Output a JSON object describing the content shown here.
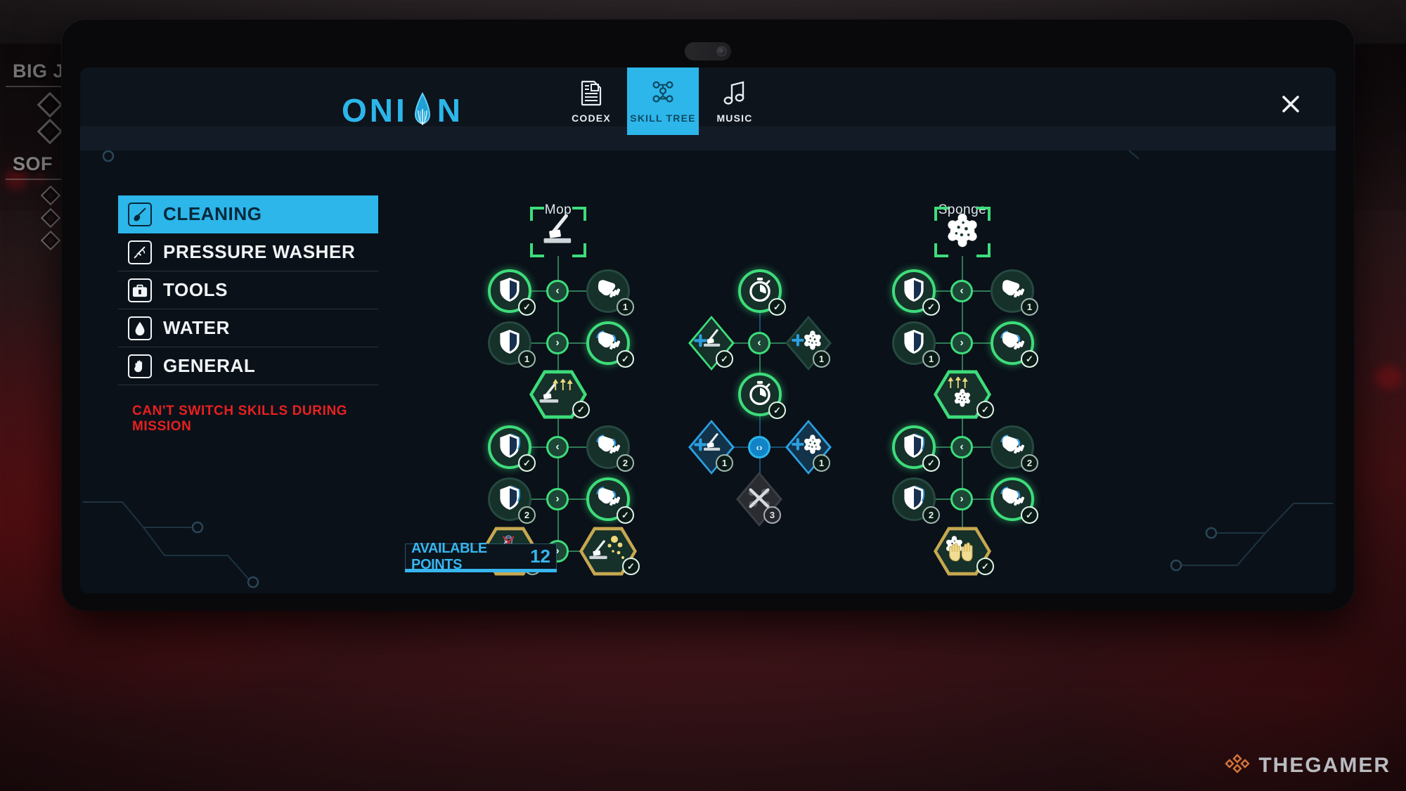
{
  "background": {
    "hud": [
      {
        "label": "BIG J",
        "name": "hud-objective-primary"
      },
      {
        "label": "SOF",
        "name": "hud-objective-secondary"
      }
    ]
  },
  "app": {
    "logo_text_left": "ONI",
    "logo_text_right": "N",
    "logo_icon": "onion-drop-icon",
    "close_icon": "close-icon"
  },
  "tabs": [
    {
      "label": "CODEX",
      "icon": "codex-document-icon",
      "active": false
    },
    {
      "label": "SKILL TREE",
      "icon": "skill-tree-nodes-icon",
      "active": true
    },
    {
      "label": "MUSIC",
      "icon": "music-note-icon",
      "active": false
    }
  ],
  "sidebar": {
    "items": [
      {
        "label": "CLEANING",
        "icon": "mop-square-icon",
        "active": true
      },
      {
        "label": "PRESSURE WASHER",
        "icon": "pressure-washer-icon",
        "active": false
      },
      {
        "label": "TOOLS",
        "icon": "toolbox-icon",
        "active": false
      },
      {
        "label": "WATER",
        "icon": "water-drop-icon",
        "active": false
      },
      {
        "label": "GENERAL",
        "icon": "hand-icon",
        "active": false
      }
    ],
    "warning": "CAN'T SWITCH SKILLS DURING MISSION"
  },
  "tree": {
    "columns": [
      {
        "title": "Mop",
        "root_icon": "mop-icon"
      },
      {
        "title": "Sponge",
        "root_icon": "sponge-icon"
      }
    ],
    "nodes": [
      {
        "name": "mop-durability-1",
        "icon": "shield-icon",
        "state": "unlocked",
        "badge": "check",
        "shape": "circle"
      },
      {
        "name": "mop-speed-1",
        "icon": "glove-icon",
        "state": "locked",
        "badge": "1",
        "shape": "circle"
      },
      {
        "name": "mop-durability-2",
        "icon": "shield-icon",
        "state": "locked",
        "badge": "1",
        "shape": "circle"
      },
      {
        "name": "mop-speed-2",
        "icon": "glove-icon",
        "state": "unlocked",
        "badge": "check",
        "shape": "circle"
      },
      {
        "name": "mop-upgrade-hex",
        "icon": "mop-upgrade-icon",
        "state": "unlocked",
        "badge": "check",
        "shape": "hex-green"
      },
      {
        "name": "mop-durability-3",
        "icon": "shield-icon",
        "state": "unlocked",
        "badge": "check",
        "shape": "circle"
      },
      {
        "name": "mop-speed-3",
        "icon": "glove-icon",
        "state": "locked",
        "badge": "2",
        "shape": "circle"
      },
      {
        "name": "mop-durability-4",
        "icon": "shield-icon",
        "state": "locked",
        "badge": "2",
        "shape": "circle"
      },
      {
        "name": "mop-speed-4",
        "icon": "glove-icon",
        "state": "unlocked",
        "badge": "check",
        "shape": "circle"
      },
      {
        "name": "mop-no-bucket-hex",
        "icon": "mop-no-bucket-icon",
        "state": "locked",
        "badge": "4",
        "shape": "hex-gold"
      },
      {
        "name": "mop-sparkle-hex",
        "icon": "mop-sparkle-icon",
        "state": "unlocked",
        "badge": "check",
        "shape": "hex-gold"
      },
      {
        "name": "water-timer-1",
        "icon": "stopwatch-icon",
        "state": "unlocked",
        "badge": "check",
        "shape": "circle"
      },
      {
        "name": "water-mop-plus-1",
        "icon": "plus-mop-icon",
        "state": "unlocked",
        "badge": "check",
        "shape": "diamond-green"
      },
      {
        "name": "water-sponge-plus-1",
        "icon": "plus-sponge-icon",
        "state": "locked",
        "badge": "1",
        "shape": "diamond-off"
      },
      {
        "name": "water-timer-2",
        "icon": "stopwatch-icon",
        "state": "unlocked",
        "badge": "check",
        "shape": "circle"
      },
      {
        "name": "water-mop-plus-2",
        "icon": "plus-mop-icon",
        "state": "available",
        "badge": "1",
        "shape": "diamond-blue"
      },
      {
        "name": "water-sponge-plus-2",
        "icon": "plus-sponge-icon",
        "state": "available",
        "badge": "1",
        "shape": "diamond-blue"
      },
      {
        "name": "water-debris-x",
        "icon": "debris-x-icon",
        "state": "disabled",
        "badge": "3",
        "shape": "diamond-dim"
      },
      {
        "name": "sponge-durability-1",
        "icon": "shield-icon",
        "state": "unlocked",
        "badge": "check",
        "shape": "circle"
      },
      {
        "name": "sponge-speed-1",
        "icon": "glove-icon",
        "state": "locked",
        "badge": "1",
        "shape": "circle"
      },
      {
        "name": "sponge-durability-2",
        "icon": "shield-icon",
        "state": "locked",
        "badge": "1",
        "shape": "circle"
      },
      {
        "name": "sponge-speed-2",
        "icon": "glove-icon",
        "state": "unlocked",
        "badge": "check",
        "shape": "circle"
      },
      {
        "name": "sponge-upgrade-hex",
        "icon": "sponge-upgrade-icon",
        "state": "unlocked",
        "badge": "check",
        "shape": "hex-green"
      },
      {
        "name": "sponge-durability-3",
        "icon": "shield-icon",
        "state": "unlocked",
        "badge": "check",
        "shape": "circle"
      },
      {
        "name": "sponge-speed-3",
        "icon": "glove-icon",
        "state": "locked",
        "badge": "2",
        "shape": "circle"
      },
      {
        "name": "sponge-durability-4",
        "icon": "shield-icon",
        "state": "locked",
        "badge": "2",
        "shape": "circle"
      },
      {
        "name": "sponge-speed-4",
        "icon": "glove-icon",
        "state": "unlocked",
        "badge": "check",
        "shape": "circle"
      },
      {
        "name": "sponge-hands-hex",
        "icon": "sponge-hands-icon",
        "state": "unlocked",
        "badge": "check",
        "shape": "hex-gold"
      }
    ],
    "connectors": [
      {
        "name": "mop-conn-1",
        "glyph": "‹",
        "state": "green"
      },
      {
        "name": "mop-conn-2",
        "glyph": "›",
        "state": "green"
      },
      {
        "name": "mop-conn-3",
        "glyph": "‹",
        "state": "green"
      },
      {
        "name": "mop-conn-4",
        "glyph": "›",
        "state": "green"
      },
      {
        "name": "mop-conn-5",
        "glyph": "›",
        "state": "green"
      },
      {
        "name": "water-conn-1",
        "glyph": "‹",
        "state": "green"
      },
      {
        "name": "water-conn-2",
        "glyph": "‹›",
        "state": "cyan"
      },
      {
        "name": "sponge-conn-1",
        "glyph": "‹",
        "state": "green"
      },
      {
        "name": "sponge-conn-2",
        "glyph": "›",
        "state": "green"
      },
      {
        "name": "sponge-conn-3",
        "glyph": "‹",
        "state": "green"
      },
      {
        "name": "sponge-conn-4",
        "glyph": "›",
        "state": "green"
      }
    ]
  },
  "footer": {
    "points_label": "AVAILABLE POINTS",
    "points_value": "12"
  },
  "watermark": {
    "text": "THEGAMER",
    "icon": "thegamer-logo-icon"
  },
  "colors": {
    "accent_cyan": "#2cb6ea",
    "unlocked_green": "#3ddc7a",
    "gold": "#c7a850",
    "warning_red": "#e82020",
    "panel_bg": "#0a1119"
  }
}
